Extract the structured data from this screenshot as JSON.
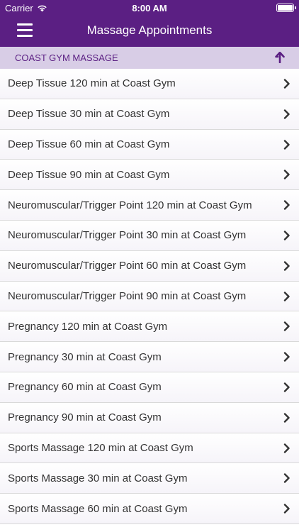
{
  "status_bar": {
    "carrier": "Carrier",
    "time": "8:00 AM",
    "battery_level": 1.0
  },
  "nav": {
    "title": "Massage Appointments",
    "menu_icon": "hamburger-menu-icon"
  },
  "section": {
    "title": "COAST GYM MASSAGE",
    "icon": "arrow-up-icon"
  },
  "colors": {
    "header_bg": "#5b1f83",
    "section_bg": "#d8cde6",
    "section_text": "#5b1f83"
  },
  "items": [
    {
      "label": "Deep Tissue 120 min at Coast Gym"
    },
    {
      "label": "Deep Tissue 30 min at Coast Gym"
    },
    {
      "label": "Deep Tissue 60 min at Coast Gym"
    },
    {
      "label": "Deep Tissue 90 min at Coast Gym"
    },
    {
      "label": "Neuromuscular/Trigger Point 120 min at Coast Gym"
    },
    {
      "label": "Neuromuscular/Trigger Point 30 min at Coast Gym"
    },
    {
      "label": "Neuromuscular/Trigger Point 60 min at Coast Gym"
    },
    {
      "label": "Neuromuscular/Trigger Point 90 min at Coast Gym"
    },
    {
      "label": "Pregnancy 120 min at Coast Gym"
    },
    {
      "label": "Pregnancy 30 min at Coast Gym"
    },
    {
      "label": "Pregnancy 60 min at Coast Gym"
    },
    {
      "label": "Pregnancy 90 min at Coast Gym"
    },
    {
      "label": "Sports Massage 120 min at Coast Gym"
    },
    {
      "label": "Sports Massage 30 min at Coast Gym"
    },
    {
      "label": "Sports Massage 60 min at Coast Gym"
    }
  ]
}
